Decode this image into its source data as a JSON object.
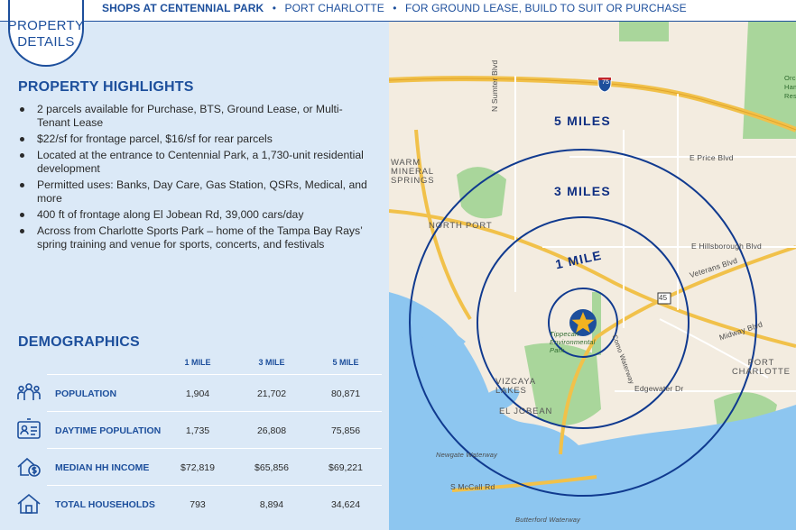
{
  "header": {
    "title": "SHOPS AT CENTENNIAL PARK",
    "separator": "•",
    "location": "PORT CHARLOTTE",
    "purpose": "FOR GROUND LEASE, BUILD TO SUIT OR PURCHASE"
  },
  "badge": {
    "line1": "PROPERTY",
    "line2": "DETAILS"
  },
  "highlights": {
    "title": "PROPERTY HIGHLIGHTS",
    "items": [
      "2 parcels available for Purchase, BTS, Ground Lease, or Multi-Tenant Lease",
      "$22/sf for frontage parcel, $16/sf for rear parcels",
      "Located at the entrance to Centennial Park, a 1,730-unit residential development",
      "Permitted uses: Banks, Day Care, Gas Station, QSRs, Medical, and more",
      "400 ft of frontage along El Jobean Rd, 39,000 cars/day",
      "Across from Charlotte Sports Park – home of the Tampa Bay Rays’ spring training and venue for sports, concerts, and festivals"
    ]
  },
  "demographics": {
    "title": "DEMOGRAPHICS",
    "columns": [
      "1 MILE",
      "3 MILE",
      "5 MILE"
    ],
    "rows": [
      {
        "icon": "people-group-icon",
        "label": "POPULATION",
        "values": [
          "1,904",
          "21,702",
          "80,871"
        ]
      },
      {
        "icon": "id-badge-icon",
        "label": "DAYTIME POPULATION",
        "values": [
          "1,735",
          "26,808",
          "75,856"
        ]
      },
      {
        "icon": "house-dollar-icon",
        "label": "MEDIAN HH INCOME",
        "values": [
          "$72,819",
          "$65,856",
          "$69,221"
        ]
      },
      {
        "icon": "house-icon",
        "label": "TOTAL HOUSEHOLDS",
        "values": [
          "793",
          "8,894",
          "34,624"
        ]
      }
    ]
  },
  "map": {
    "ring_labels": [
      "5 MILES",
      "3 MILES",
      "1 MILE"
    ],
    "interstate": "75",
    "state_route": "45",
    "roads": {
      "n_sumter": "N Sumter Blvd",
      "price": "E Price Blvd",
      "hillsborough": "E Hillsborough Blvd",
      "veterans": "Veterans Blvd",
      "midway": "Midway Blvd",
      "edgewater": "Edgewater Dr",
      "mccall": "S McCall Rd",
      "como": "Como Waterway",
      "newgate": "Newgate Waterway",
      "butterford": "Butterford Waterway"
    },
    "places": {
      "warm_springs": [
        "WARM",
        "MINERAL",
        "SPRINGS"
      ],
      "north_port": "NORTH PORT",
      "port_charlotte": [
        "PORT",
        "CHARLOTTE"
      ],
      "vizcaya": [
        "VIZCAYA",
        "LAKES"
      ],
      "el_jobean": "EL JOBEAN",
      "tippecanoe": [
        "Tippecan",
        "Environmental",
        "Park"
      ],
      "edge_fragments": [
        "Orc",
        "Ham",
        "Res"
      ]
    },
    "colors": {
      "ring": "#103a8f",
      "star": "#f2b320",
      "water": "#8dc6f0",
      "park": "#a9d69b",
      "land": "#f3ece0",
      "road": "#f1c14a"
    }
  }
}
